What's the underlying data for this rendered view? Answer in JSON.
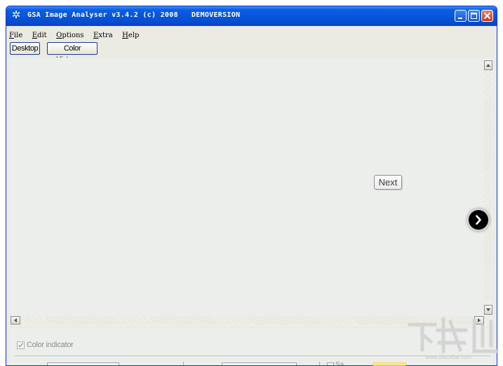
{
  "window": {
    "title": "GSA Image Analyser v3.4.2 (c) 2008   DEMOVERSION",
    "app_icon": "gear-icon"
  },
  "menu": {
    "items": [
      {
        "label": "File",
        "hotkey": "F"
      },
      {
        "label": "Edit",
        "hotkey": "E"
      },
      {
        "label": "Options",
        "hotkey": "O"
      },
      {
        "label": "Extra",
        "hotkey": "E"
      },
      {
        "label": "Help",
        "hotkey": "H"
      }
    ]
  },
  "toolbar": {
    "tabs": [
      {
        "label": "Desktop"
      },
      {
        "label": "Color Histogram"
      }
    ]
  },
  "overlay": {
    "next_label": "Next",
    "next_icon": "chevron-right-icon"
  },
  "bottom": {
    "color_indicator_label": "Color indicator",
    "color_indicator_checked": true,
    "partial_label": "Sa"
  },
  "watermark": {
    "url": "www.xiazaiba.com"
  },
  "colors": {
    "titlebar": "#0553d8",
    "close_button": "#c6341c",
    "window_face": "#ebebe4",
    "content_bg": "#eceeec"
  }
}
